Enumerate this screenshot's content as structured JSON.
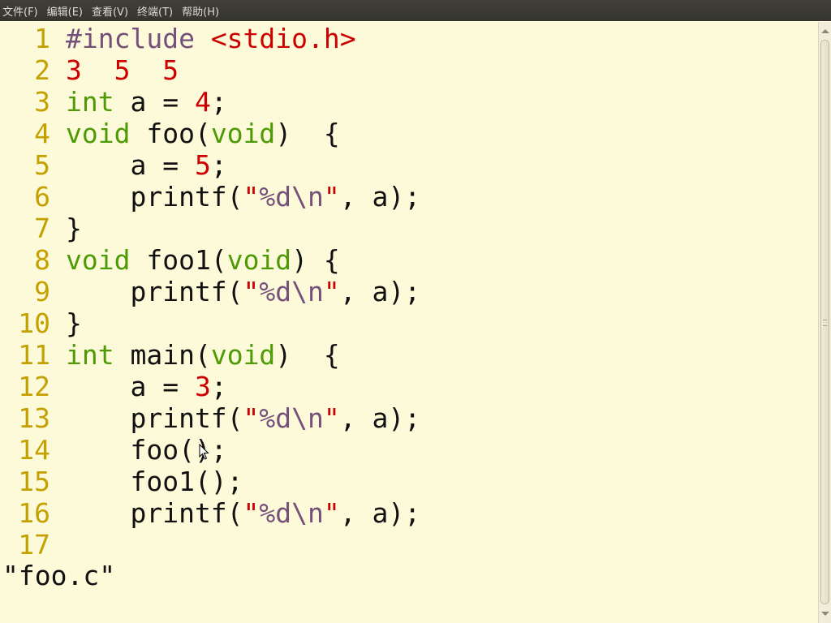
{
  "menubar": {
    "items": [
      "文件(F)",
      "编辑(E)",
      "查看(V)",
      "终端(T)",
      "帮助(H)"
    ]
  },
  "editor": {
    "lines": [
      {
        "n": "1",
        "tokens": [
          {
            "t": "#include ",
            "c": "pp"
          },
          {
            "t": "<stdio.h>",
            "c": "str"
          }
        ]
      },
      {
        "n": "2",
        "tokens": [
          {
            "t": "3  5  5",
            "c": "num"
          }
        ]
      },
      {
        "n": "3",
        "tokens": [
          {
            "t": "int",
            "c": "type"
          },
          {
            "t": " a = ",
            "c": "plain"
          },
          {
            "t": "4",
            "c": "num"
          },
          {
            "t": ";",
            "c": "plain"
          }
        ]
      },
      {
        "n": "4",
        "tokens": [
          {
            "t": "void",
            "c": "type"
          },
          {
            "t": " foo(",
            "c": "plain"
          },
          {
            "t": "void",
            "c": "type"
          },
          {
            "t": ")  {",
            "c": "plain"
          }
        ]
      },
      {
        "n": "5",
        "tokens": [
          {
            "t": "    a = ",
            "c": "plain"
          },
          {
            "t": "5",
            "c": "num"
          },
          {
            "t": ";",
            "c": "plain"
          }
        ]
      },
      {
        "n": "6",
        "tokens": [
          {
            "t": "    printf(",
            "c": "plain"
          },
          {
            "t": "\"",
            "c": "str"
          },
          {
            "t": "%d",
            "c": "strtxt"
          },
          {
            "t": "\\n",
            "c": "esc"
          },
          {
            "t": "\"",
            "c": "str"
          },
          {
            "t": ", a);",
            "c": "plain"
          }
        ]
      },
      {
        "n": "7",
        "tokens": [
          {
            "t": "}",
            "c": "plain"
          }
        ]
      },
      {
        "n": "8",
        "tokens": [
          {
            "t": "void",
            "c": "type"
          },
          {
            "t": " foo1(",
            "c": "plain"
          },
          {
            "t": "void",
            "c": "type"
          },
          {
            "t": ") {",
            "c": "plain"
          }
        ]
      },
      {
        "n": "9",
        "tokens": [
          {
            "t": "    printf(",
            "c": "plain"
          },
          {
            "t": "\"",
            "c": "str"
          },
          {
            "t": "%d",
            "c": "strtxt"
          },
          {
            "t": "\\n",
            "c": "esc"
          },
          {
            "t": "\"",
            "c": "str"
          },
          {
            "t": ", a);",
            "c": "plain"
          }
        ]
      },
      {
        "n": "10",
        "tokens": [
          {
            "t": "}",
            "c": "plain"
          }
        ]
      },
      {
        "n": "11",
        "tokens": [
          {
            "t": "int",
            "c": "type"
          },
          {
            "t": " main(",
            "c": "plain"
          },
          {
            "t": "void",
            "c": "type"
          },
          {
            "t": ")  {",
            "c": "plain"
          }
        ]
      },
      {
        "n": "12",
        "tokens": [
          {
            "t": "    a = ",
            "c": "plain"
          },
          {
            "t": "3",
            "c": "num"
          },
          {
            "t": ";",
            "c": "plain"
          }
        ]
      },
      {
        "n": "13",
        "tokens": [
          {
            "t": "    printf(",
            "c": "plain"
          },
          {
            "t": "\"",
            "c": "str"
          },
          {
            "t": "%d",
            "c": "strtxt"
          },
          {
            "t": "\\n",
            "c": "esc"
          },
          {
            "t": "\"",
            "c": "str"
          },
          {
            "t": ", a);",
            "c": "plain"
          }
        ]
      },
      {
        "n": "14",
        "tokens": [
          {
            "t": "    foo();",
            "c": "plain"
          }
        ]
      },
      {
        "n": "15",
        "tokens": [
          {
            "t": "    foo1();",
            "c": "plain"
          }
        ]
      },
      {
        "n": "16",
        "tokens": [
          {
            "t": "    printf(",
            "c": "plain"
          },
          {
            "t": "\"",
            "c": "str"
          },
          {
            "t": "%d",
            "c": "strtxt"
          },
          {
            "t": "\\n",
            "c": "esc"
          },
          {
            "t": "\"",
            "c": "str"
          },
          {
            "t": ", a);",
            "c": "plain"
          }
        ]
      },
      {
        "n": "17",
        "tokens": []
      }
    ]
  },
  "status": {
    "text": "\"foo.c\""
  },
  "colors": {
    "background": "#fcfad8",
    "line_number": "#c4a000",
    "keyword_type": "#4e9a06",
    "string": "#cc0000",
    "preprocessor": "#75507b",
    "menubar": "#3c3b37"
  },
  "icons": {
    "pointer": "mouse-pointer-icon"
  }
}
